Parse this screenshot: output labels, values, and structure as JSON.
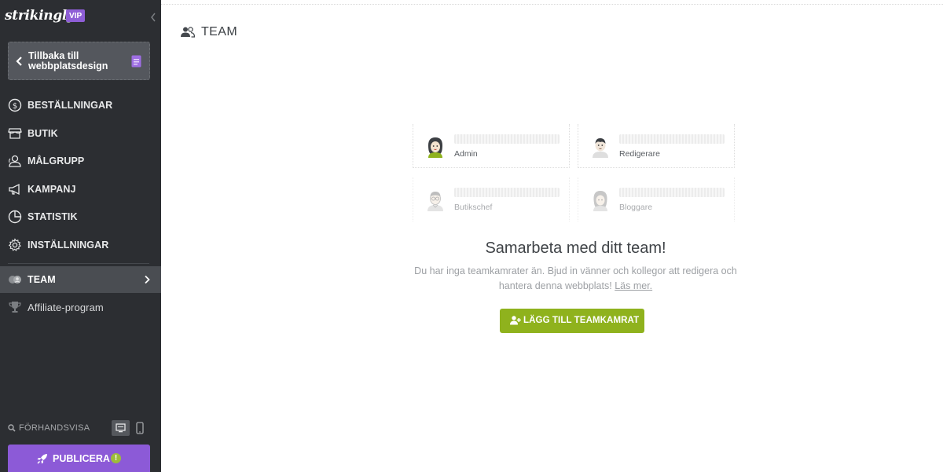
{
  "brand": {
    "logo_text": "strikingly",
    "badge": "VIP",
    "accent": "#8c5ad7"
  },
  "sidebar": {
    "back_button": {
      "line1": "Tillbaka till",
      "line2": "webbplatsdesign"
    },
    "items": [
      {
        "label": "BESTÄLLNINGAR",
        "icon": "dollar-circle-icon"
      },
      {
        "label": "BUTIK",
        "icon": "store-icon"
      },
      {
        "label": "MÅLGRUPP",
        "icon": "audience-icon"
      },
      {
        "label": "KAMPANJ",
        "icon": "megaphone-icon"
      },
      {
        "label": "STATISTIK",
        "icon": "pie-chart-icon"
      },
      {
        "label": "INSTÄLLNINGAR",
        "icon": "gear-icon"
      },
      {
        "label": "TEAM",
        "icon": "team-icon",
        "active": true
      },
      {
        "label": "Affiliate-program",
        "icon": "trophy-icon"
      }
    ],
    "preview_label": "FÖRHANDSVISA",
    "publish_label": "PUBLICERA",
    "publish_badge": "!"
  },
  "main": {
    "title": "TEAM",
    "roles": [
      "Admin",
      "Redigerare",
      "Butikschef",
      "Bloggare"
    ],
    "headline": "Samarbeta med ditt team!",
    "description": "Du har inga teamkamrater än. Bjud in vänner och kollegor att redigera och hantera denna webbplats!",
    "learn_more": "Läs mer.",
    "add_button": "LÄGG TILL TEAMKAMRAT",
    "button_color": "#8fb21d"
  }
}
